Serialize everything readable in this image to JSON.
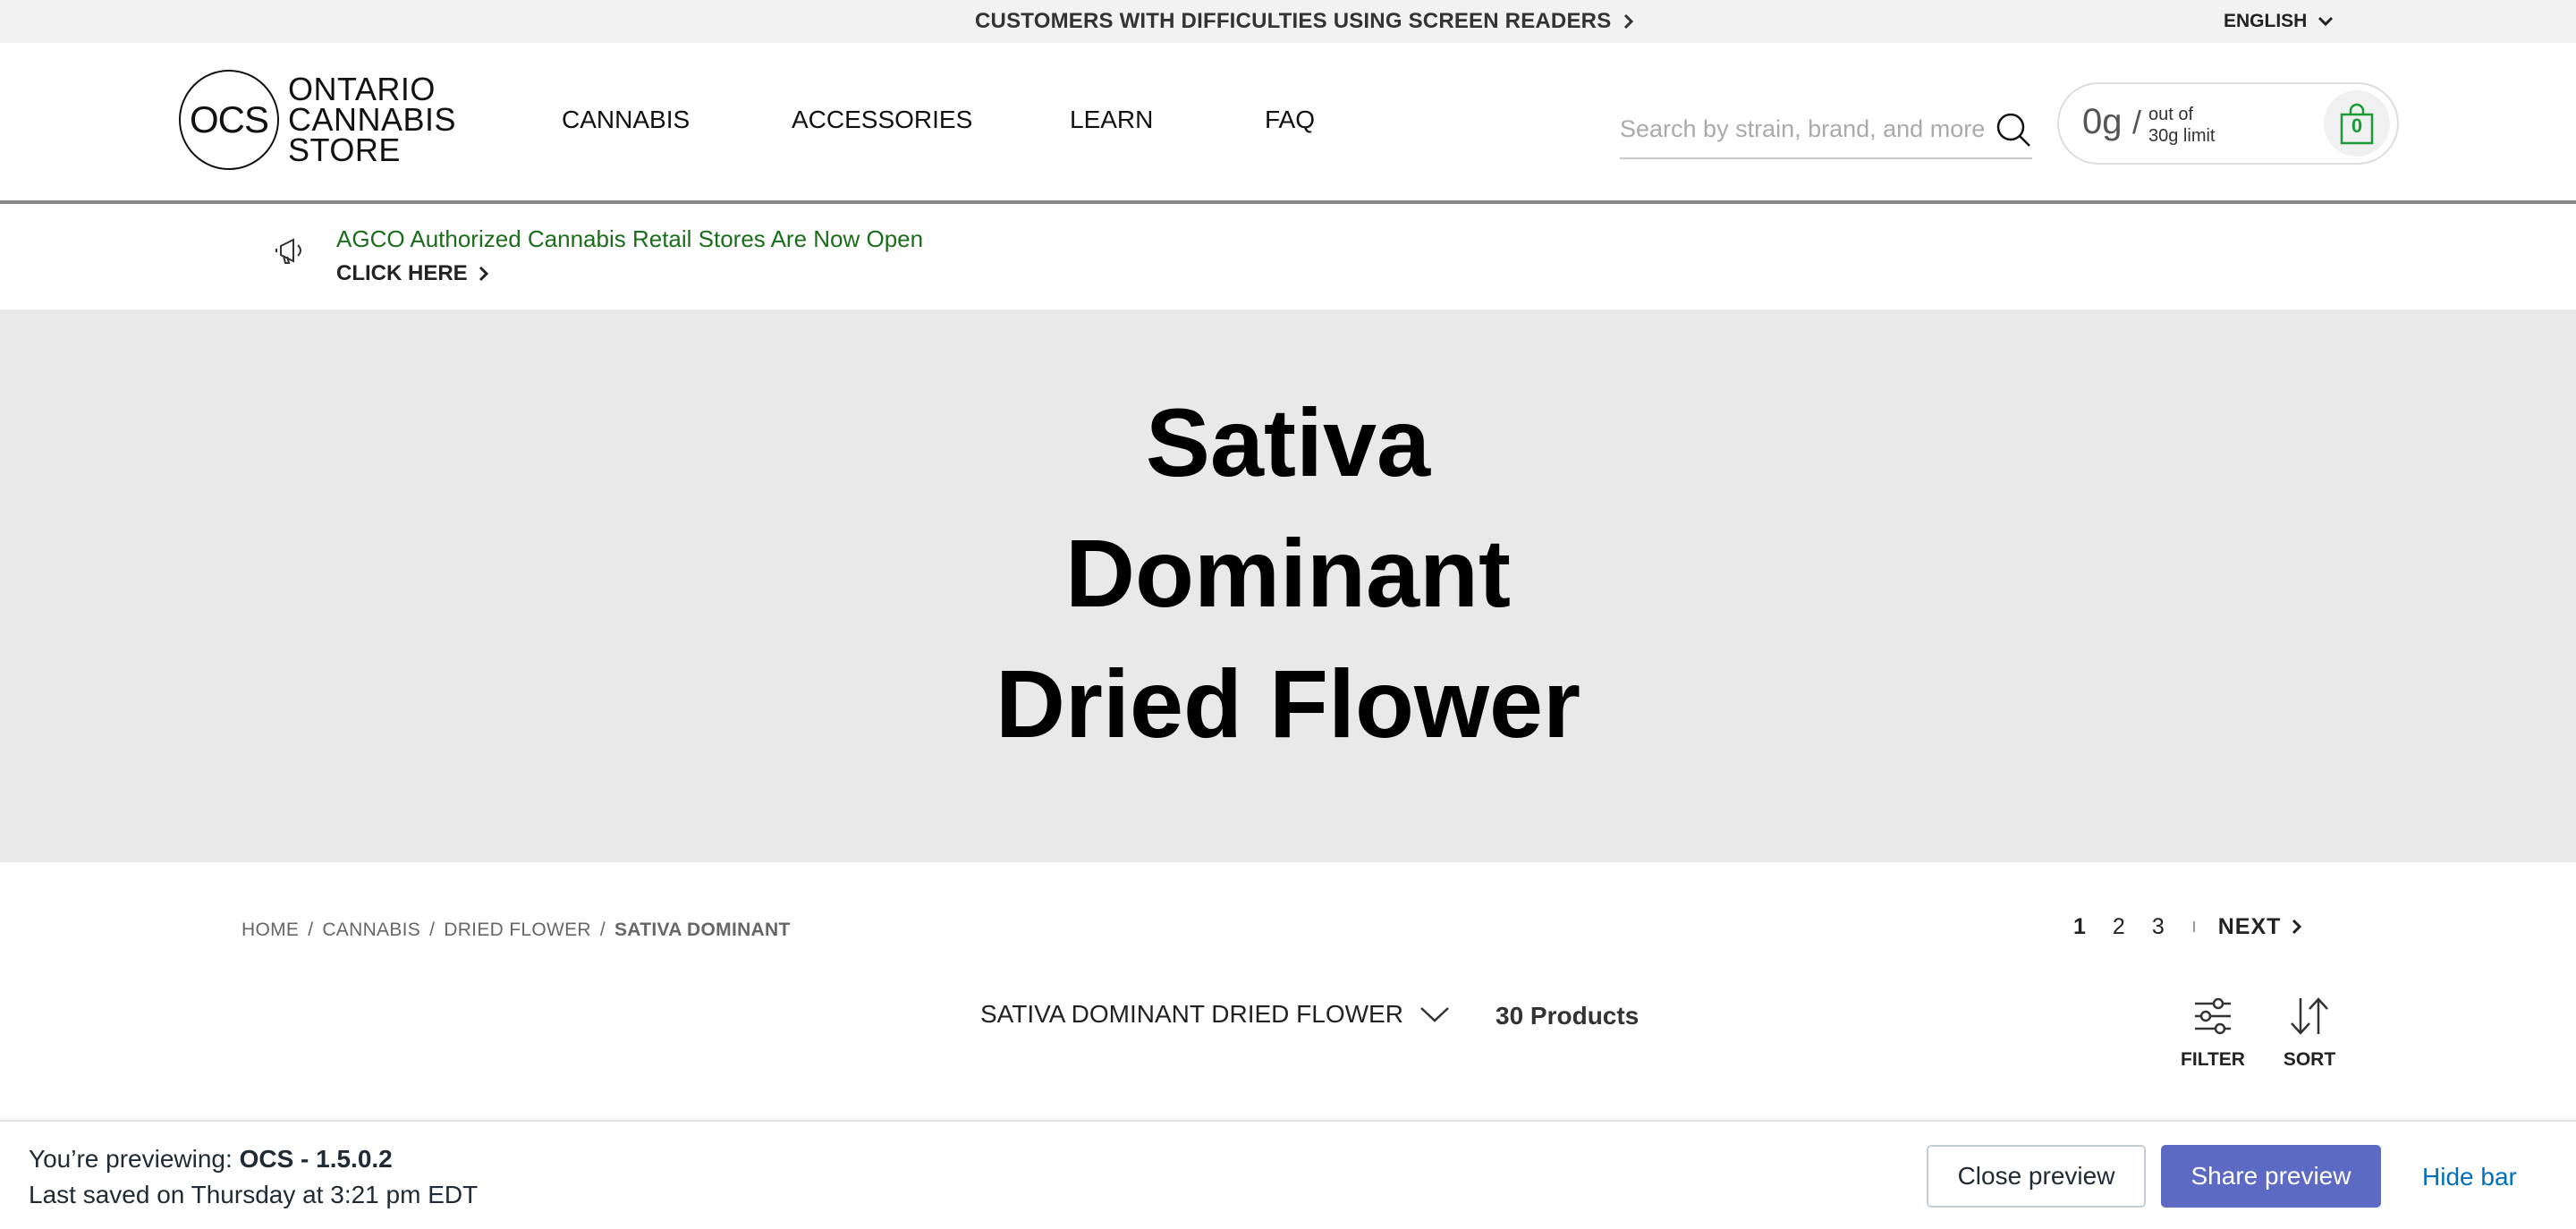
{
  "topbar": {
    "accessibility_link": "CUSTOMERS WITH DIFFICULTIES USING SCREEN READERS",
    "language": "ENGLISH"
  },
  "header": {
    "logo": {
      "monogram": "OCS",
      "line1": "ONTARIO",
      "line2": "CANNABIS",
      "line3": "STORE"
    },
    "nav": [
      "CANNABIS",
      "ACCESSORIES",
      "LEARN",
      "FAQ"
    ],
    "search": {
      "placeholder": "Search by strain, brand, and more",
      "value": ""
    },
    "limit": {
      "amount": "0g",
      "slash": "/",
      "out_of": "out of",
      "limit_text": "30g limit",
      "cart_count": "0"
    }
  },
  "announcement": {
    "message": "AGCO Authorized Cannabis Retail Stores Are Now Open",
    "cta": "CLICK HERE"
  },
  "hero": {
    "title_line1": "Sativa",
    "title_line2": "Dominant",
    "title_line3": "Dried Flower"
  },
  "breadcrumb": [
    {
      "label": "HOME"
    },
    {
      "label": "CANNABIS"
    },
    {
      "label": "DRIED FLOWER"
    },
    {
      "label": "SATIVA DOMINANT"
    }
  ],
  "pagination": {
    "pages": [
      "1",
      "2",
      "3"
    ],
    "active_page": "1",
    "next_label": "NEXT"
  },
  "toolbar": {
    "category": "SATIVA DOMINANT DRIED FLOWER",
    "product_count": "30 Products",
    "filter_label": "FILTER",
    "sort_label": "SORT"
  },
  "preview_bar": {
    "previewing_prefix": "You’re previewing:",
    "theme_name": "OCS - 1.5.0.2",
    "last_saved": "Last saved on Thursday at 3:21 pm EDT",
    "close_label": "Close preview",
    "share_label": "Share preview",
    "hide_label": "Hide bar",
    "share_color": "#5c6ac4",
    "link_color": "#006fbb"
  },
  "colors": {
    "hero_bg": "#e9e9e9",
    "announcement_text": "#1a6d1a",
    "cart_accent": "#1a9b37"
  }
}
